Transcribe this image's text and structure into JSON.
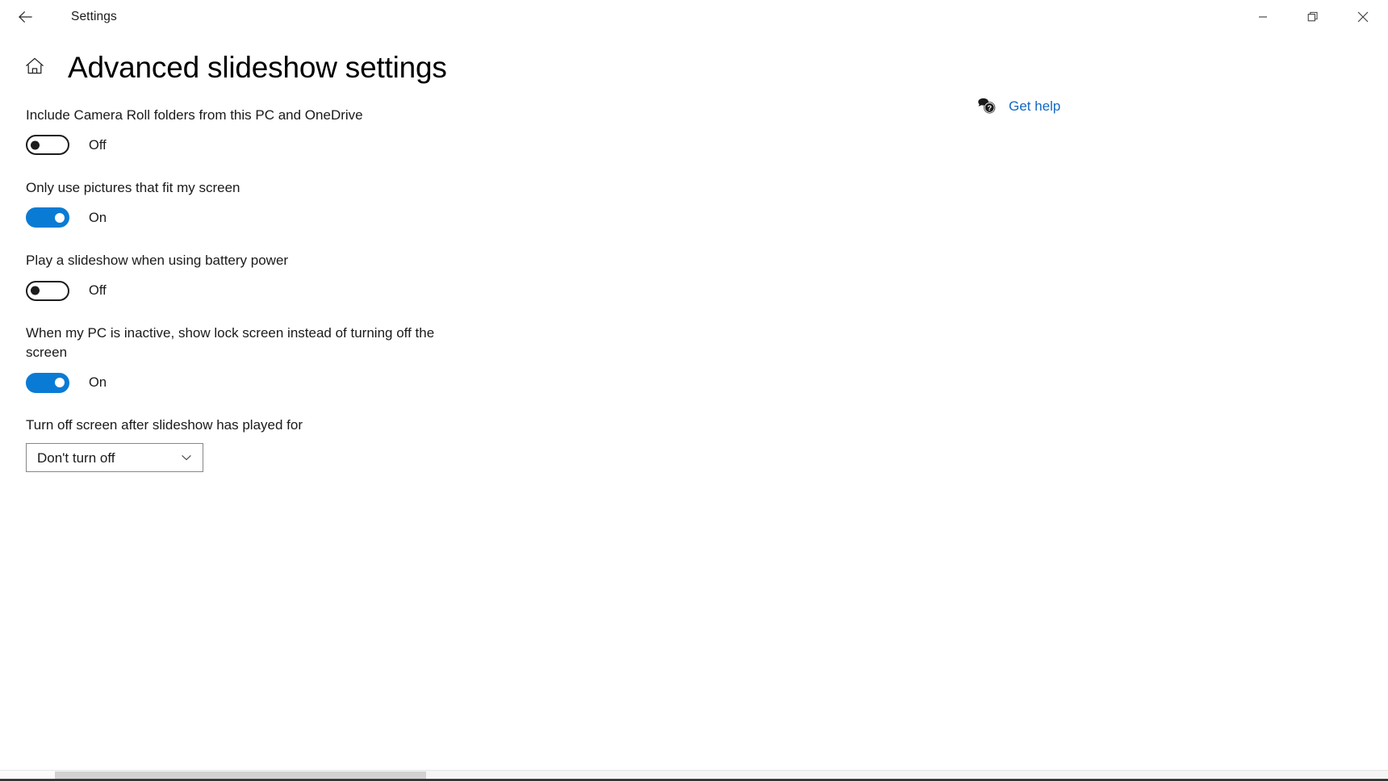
{
  "titlebar": {
    "back_icon": "back-arrow-icon",
    "app_title": "Settings",
    "minimize_icon": "minimize-icon",
    "restore_icon": "restore-icon",
    "close_icon": "close-icon"
  },
  "header": {
    "home_icon": "home-icon",
    "title": "Advanced slideshow settings"
  },
  "help": {
    "icon": "help-bubble-icon",
    "label": "Get help"
  },
  "settings": [
    {
      "label": "Include Camera Roll folders from this PC and OneDrive",
      "control": "toggle",
      "state": "off",
      "state_label": "Off"
    },
    {
      "label": "Only use pictures that fit my screen",
      "control": "toggle",
      "state": "on",
      "state_label": "On"
    },
    {
      "label": "Play a slideshow when using battery power",
      "control": "toggle",
      "state": "off",
      "state_label": "Off"
    },
    {
      "label": "When my PC is inactive, show lock screen instead of turning off the screen",
      "control": "toggle",
      "state": "on",
      "state_label": "On"
    },
    {
      "label": "Turn off screen after slideshow has played for",
      "control": "dropdown",
      "value": "Don't turn off",
      "chevron_icon": "chevron-down-icon"
    }
  ],
  "colors": {
    "accent_blue": "#0a7bd4",
    "link_blue": "#1268c3",
    "text": "#1a1a1a",
    "background": "#ffffff",
    "dropdown_border": "#868686"
  }
}
